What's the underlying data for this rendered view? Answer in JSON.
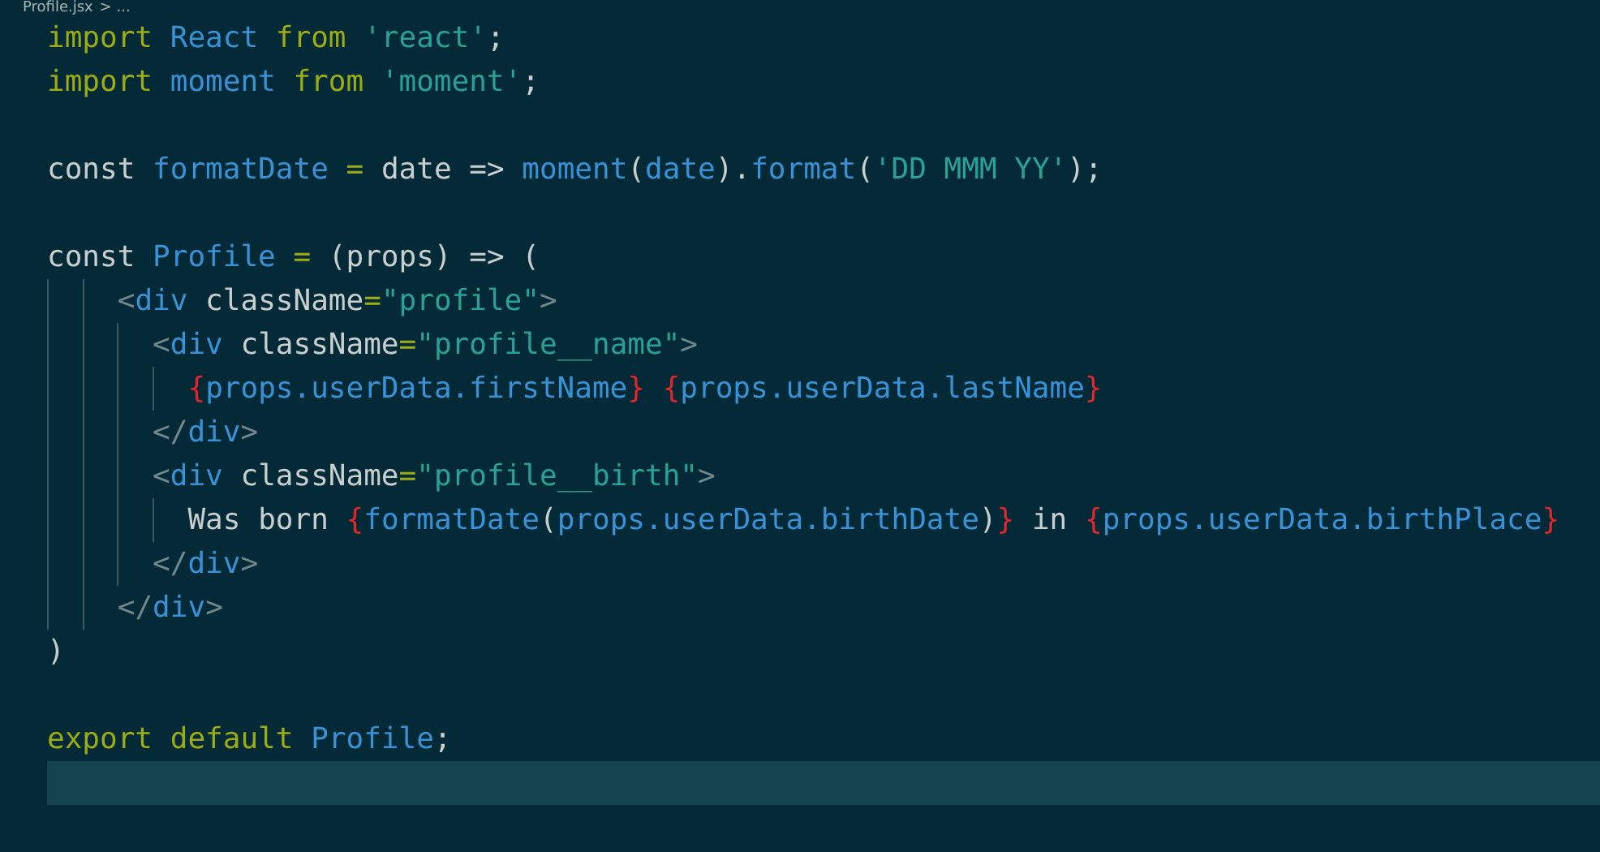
{
  "breadcrumb": {
    "file": "Profile.jsx",
    "rest": "> ..."
  },
  "lines": [
    {
      "current": false,
      "tokens": [
        {
          "kind": "keyword",
          "text": "import "
        },
        {
          "kind": "ident",
          "text": "React "
        },
        {
          "kind": "keyword",
          "text": "from "
        },
        {
          "kind": "string",
          "text": "'react'"
        },
        {
          "kind": "plain",
          "text": ";"
        }
      ]
    },
    {
      "current": false,
      "tokens": [
        {
          "kind": "keyword",
          "text": "import "
        },
        {
          "kind": "ident",
          "text": "moment "
        },
        {
          "kind": "keyword",
          "text": "from "
        },
        {
          "kind": "string",
          "text": "'moment'"
        },
        {
          "kind": "plain",
          "text": ";"
        }
      ]
    },
    {
      "current": false
    },
    {
      "current": false,
      "tokens": [
        {
          "kind": "plain",
          "text": "const "
        },
        {
          "kind": "ident",
          "text": "formatDate "
        },
        {
          "kind": "keyword",
          "text": "= "
        },
        {
          "kind": "plain",
          "text": "date => "
        },
        {
          "kind": "ident",
          "text": "moment"
        },
        {
          "kind": "plain",
          "text": "("
        },
        {
          "kind": "ident",
          "text": "date"
        },
        {
          "kind": "plain",
          "text": ")."
        },
        {
          "kind": "ident",
          "text": "format"
        },
        {
          "kind": "plain",
          "text": "("
        },
        {
          "kind": "string",
          "text": "'DD MMM YY'"
        },
        {
          "kind": "plain",
          "text": ");"
        }
      ]
    },
    {
      "current": false
    },
    {
      "current": false,
      "tokens": [
        {
          "kind": "plain",
          "text": "const "
        },
        {
          "kind": "ident",
          "text": "Profile "
        },
        {
          "kind": "keyword",
          "text": "="
        },
        {
          "kind": "plain",
          "text": " (props) => ("
        }
      ],
      "children": [
        {
          "current": false,
          "tokens": [
            {
              "kind": "tag",
              "text": "<"
            },
            {
              "kind": "ident",
              "text": "div"
            },
            {
              "kind": "plain",
              "text": " className"
            },
            {
              "kind": "keyword",
              "text": "="
            },
            {
              "kind": "string",
              "text": "\"profile\""
            },
            {
              "kind": "tag",
              "text": ">"
            }
          ],
          "children": [
            {
              "current": false,
              "tokens": [
                {
                  "kind": "tag",
                  "text": "<"
                },
                {
                  "kind": "ident",
                  "text": "div"
                },
                {
                  "kind": "plain",
                  "text": " className"
                },
                {
                  "kind": "keyword",
                  "text": "="
                },
                {
                  "kind": "string",
                  "text": "\"profile__name\""
                },
                {
                  "kind": "tag",
                  "text": ">"
                }
              ],
              "children": [
                {
                  "current": false,
                  "tokens": [
                    {
                      "kind": "brace",
                      "text": "{"
                    },
                    {
                      "kind": "ident",
                      "text": "props.userData.firstName"
                    },
                    {
                      "kind": "brace",
                      "text": "} {"
                    },
                    {
                      "kind": "ident",
                      "text": "props.userData.lastName"
                    },
                    {
                      "kind": "brace",
                      "text": "}"
                    }
                  ]
                }
              ]
            },
            {
              "current": false,
              "tokens": [
                {
                  "kind": "tag",
                  "text": "</"
                },
                {
                  "kind": "ident",
                  "text": "div"
                },
                {
                  "kind": "tag",
                  "text": ">"
                }
              ]
            },
            {
              "current": false,
              "tokens": [
                {
                  "kind": "tag",
                  "text": "<"
                },
                {
                  "kind": "ident",
                  "text": "div"
                },
                {
                  "kind": "plain",
                  "text": " className"
                },
                {
                  "kind": "keyword",
                  "text": "="
                },
                {
                  "kind": "string",
                  "text": "\"profile__birth\""
                },
                {
                  "kind": "tag",
                  "text": ">"
                }
              ],
              "children": [
                {
                  "current": false,
                  "tokens": [
                    {
                      "kind": "plain",
                      "text": "Was born "
                    },
                    {
                      "kind": "brace",
                      "text": "{"
                    },
                    {
                      "kind": "ident",
                      "text": "formatDate"
                    },
                    {
                      "kind": "plain",
                      "text": "("
                    },
                    {
                      "kind": "ident",
                      "text": "props.userData.birthDate"
                    },
                    {
                      "kind": "plain",
                      "text": ")"
                    },
                    {
                      "kind": "brace",
                      "text": "}"
                    },
                    {
                      "kind": "plain",
                      "text": " in "
                    },
                    {
                      "kind": "brace",
                      "text": "{"
                    },
                    {
                      "kind": "ident",
                      "text": "props.userData.birthPlace"
                    },
                    {
                      "kind": "brace",
                      "text": "}"
                    }
                  ]
                }
              ]
            },
            {
              "current": false,
              "tokens": [
                {
                  "kind": "tag",
                  "text": "</"
                },
                {
                  "kind": "ident",
                  "text": "div"
                },
                {
                  "kind": "tag",
                  "text": ">"
                }
              ]
            }
          ]
        },
        {
          "current": false,
          "tokens": [
            {
              "kind": "tag",
              "text": "</"
            },
            {
              "kind": "ident",
              "text": "div"
            },
            {
              "kind": "tag",
              "text": ">"
            }
          ]
        }
      ]
    },
    {
      "current": false,
      "tokens": [
        {
          "kind": "plain",
          "text": ")"
        }
      ]
    },
    {
      "current": false
    },
    {
      "current": false,
      "tokens": [
        {
          "kind": "keyword",
          "text": "export default "
        },
        {
          "kind": "ident",
          "text": "Profile"
        },
        {
          "kind": "plain",
          "text": ";"
        }
      ]
    },
    {
      "current": true
    }
  ]
}
